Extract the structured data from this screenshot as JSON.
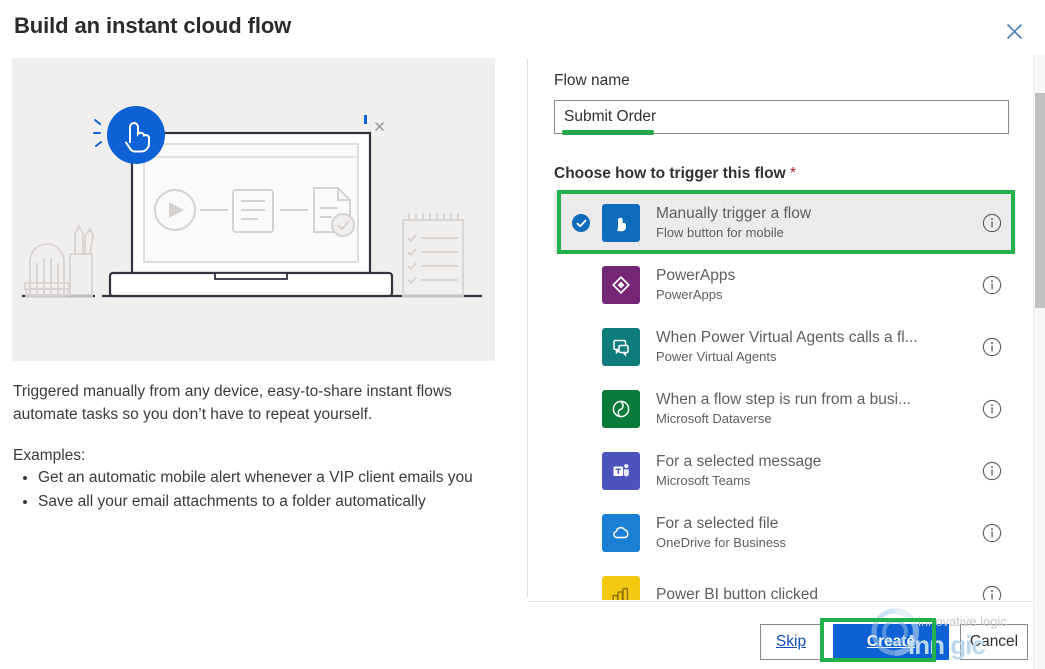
{
  "header": {
    "title": "Build an instant cloud flow",
    "close_icon": "close-icon"
  },
  "left_panel": {
    "illustration_alt": "laptop-flow-illustration",
    "description": "Triggered manually from any device, easy-to-share instant flows automate tasks so you don’t have to repeat yourself.",
    "examples_label": "Examples:",
    "examples": [
      "Get an automatic mobile alert whenever a VIP client emails you",
      "Save all your email attachments to a folder automatically"
    ]
  },
  "form": {
    "flow_name_label": "Flow name",
    "flow_name_value": "Submit Order",
    "flow_name_placeholder": "Flow name",
    "trigger_label": "Choose how to trigger this flow",
    "required_marker": "*"
  },
  "triggers": [
    {
      "title": "Manually trigger a flow",
      "subtitle": "Flow button for mobile",
      "icon": "flow-button-icon",
      "icon_color": "#0f6cbd",
      "selected": true
    },
    {
      "title": "PowerApps",
      "subtitle": "PowerApps",
      "icon": "powerapps-icon",
      "icon_color": "#742774",
      "selected": false
    },
    {
      "title": "When Power Virtual Agents calls a fl...",
      "subtitle": "Power Virtual Agents",
      "icon": "power-virtual-agents-icon",
      "icon_color": "#0f7c7c",
      "selected": false
    },
    {
      "title": "When a flow step is run from a busi...",
      "subtitle": "Microsoft Dataverse",
      "icon": "dataverse-icon",
      "icon_color": "#0a7a38",
      "selected": false
    },
    {
      "title": "For a selected message",
      "subtitle": "Microsoft Teams",
      "icon": "microsoft-teams-icon",
      "icon_color": "#4b53bc",
      "selected": false
    },
    {
      "title": "For a selected file",
      "subtitle": "OneDrive for Business",
      "icon": "onedrive-icon",
      "icon_color": "#1b7fd4",
      "selected": false
    },
    {
      "title": "Power BI button clicked",
      "subtitle": "",
      "icon": "power-bi-icon",
      "icon_color": "#f2c811",
      "selected": false
    }
  ],
  "footer": {
    "skip_label": "Skip",
    "create_label": "Create",
    "cancel_label": "Cancel"
  },
  "annotations": {
    "highlight_color": "#22b14c",
    "underline_color": "#23a84c"
  },
  "watermark": {
    "line1": "innovative logic",
    "line2": "inn gic"
  }
}
